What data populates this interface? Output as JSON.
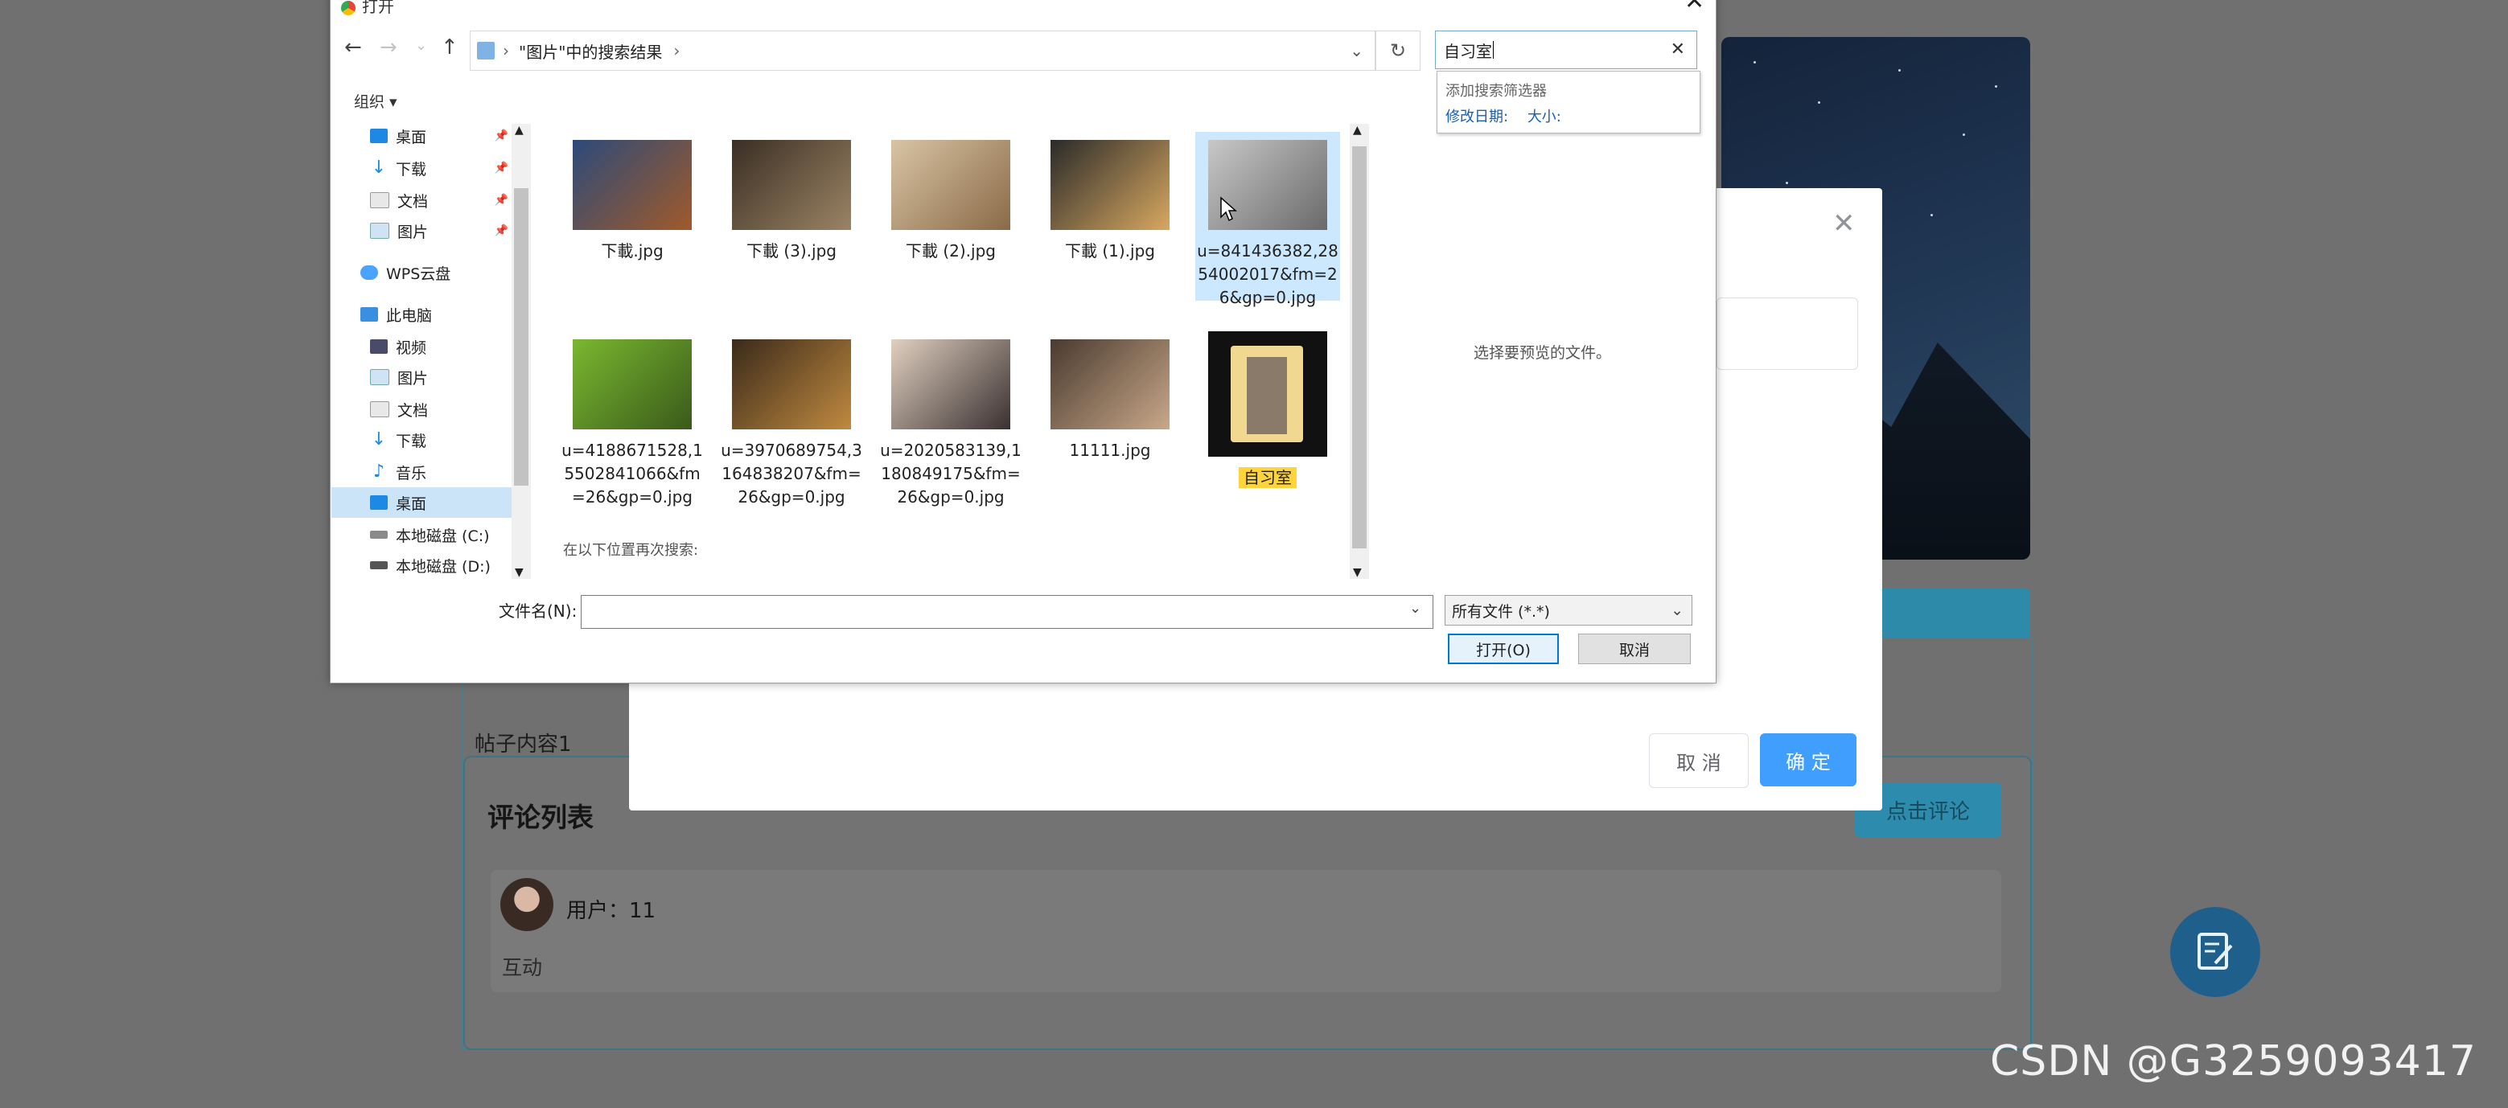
{
  "background_page": {
    "post_content": "帖子内容1",
    "comment_list_title": "评论列表",
    "comment_button": "点击评论",
    "comments": [
      {
        "user": "用户：11",
        "text": "互动"
      }
    ]
  },
  "modal": {
    "cancel_label": "取 消",
    "confirm_label": "确 定"
  },
  "dialog": {
    "title": "打开",
    "breadcrumb": "\"图片\"中的搜索结果",
    "search_value": "自习室",
    "search_filter_heading": "添加搜索筛选器",
    "search_filter_date": "修改日期:",
    "search_filter_size": "大小:",
    "organize_label": "组织 ▾",
    "nav": [
      {
        "label": "桌面",
        "pinned": true
      },
      {
        "label": "下载",
        "pinned": true
      },
      {
        "label": "文档",
        "pinned": true
      },
      {
        "label": "图片",
        "pinned": true
      },
      {
        "label": "WPS云盘",
        "pinned": false
      },
      {
        "label": "此电脑",
        "pinned": false
      },
      {
        "label": "视频",
        "pinned": false
      },
      {
        "label": "图片",
        "pinned": false
      },
      {
        "label": "文档",
        "pinned": false
      },
      {
        "label": "下载",
        "pinned": false
      },
      {
        "label": "音乐",
        "pinned": false
      },
      {
        "label": "桌面",
        "pinned": false
      },
      {
        "label": "本地磁盘 (C:)",
        "pinned": false
      },
      {
        "label": "本地磁盘 (D:)",
        "pinned": false
      }
    ],
    "files": [
      {
        "name": "下載.jpg",
        "colors": [
          "#2c4a7a",
          "#a05a2a"
        ]
      },
      {
        "name": "下載 (3).jpg",
        "colors": [
          "#3a2e24",
          "#9b8464"
        ]
      },
      {
        "name": "下載 (2).jpg",
        "colors": [
          "#d8c4a4",
          "#8a6a48"
        ]
      },
      {
        "name": "下載 (1).jpg",
        "colors": [
          "#2a2a2a",
          "#d8a860"
        ]
      },
      {
        "name": "u=841436382,2854002017&fm=26&gp=0.jpg",
        "colors": [
          "#c8c8c8",
          "#6a6a6a"
        ]
      },
      {
        "name": "u=4188671528,15502841066&fm=26&gp=0.jpg",
        "colors": [
          "#7ab830",
          "#3a5a1a"
        ]
      },
      {
        "name": "u=3970689754,3164838207&fm=26&gp=0.jpg",
        "colors": [
          "#3a2a1a",
          "#c08a40"
        ]
      },
      {
        "name": "u=2020583139,1180849175&fm=26&gp=0.jpg",
        "colors": [
          "#e0d0c0",
          "#3a3030"
        ]
      },
      {
        "name": "11111.jpg",
        "colors": [
          "#4a3a30",
          "#c8a888"
        ]
      },
      {
        "name": "自习室",
        "colors": [
          "#f0d890",
          "#1a1a1a"
        ]
      }
    ],
    "search_again_label": "在以下位置再次搜索:",
    "preview_text": "选择要预览的文件。",
    "filename_label": "文件名(N):",
    "filename_value": "",
    "filetype_value": "所有文件 (*.*)",
    "open_label": "打开(O)",
    "cancel_label": "取消"
  },
  "watermark": "CSDN @G3259093417"
}
